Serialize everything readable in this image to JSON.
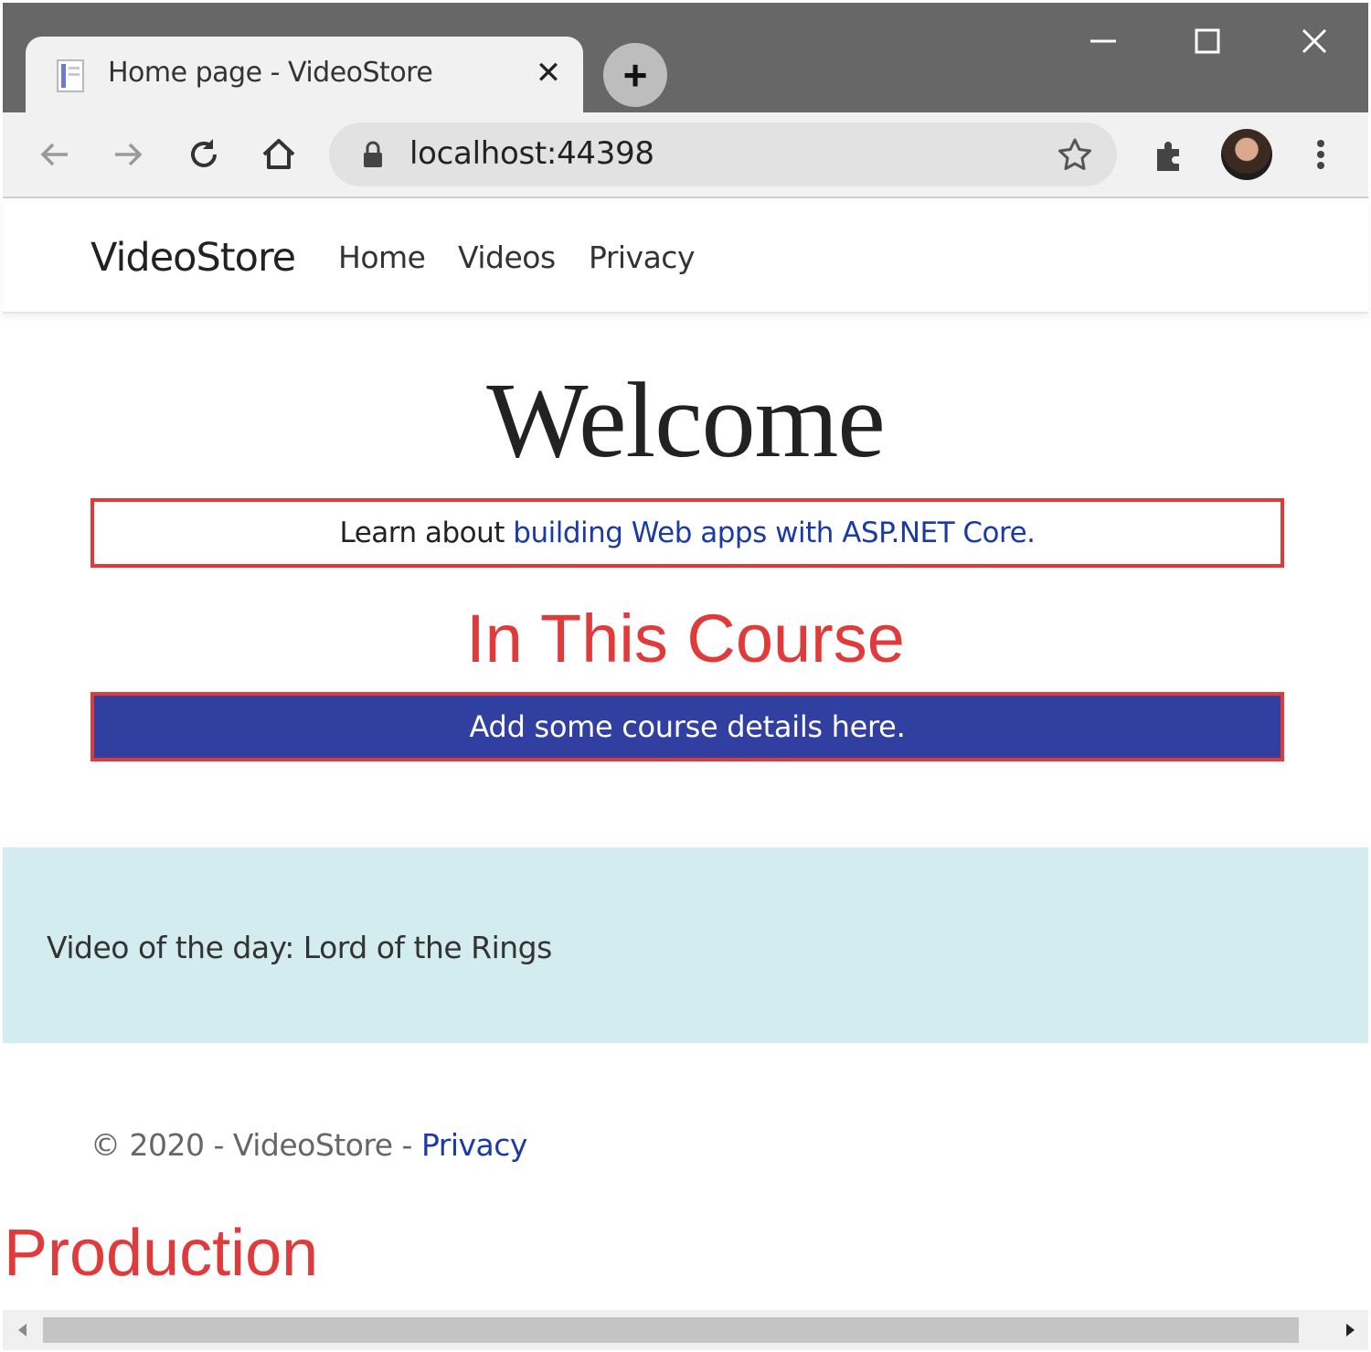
{
  "browser": {
    "tab_title": "Home page - VideoStore",
    "tab_close": "✕",
    "new_tab": "+",
    "url": "localhost:44398",
    "icons": [
      "back-icon",
      "forward-icon",
      "reload-icon",
      "home-icon",
      "lock-icon",
      "star-icon",
      "extensions-icon",
      "profile-avatar",
      "menu-icon"
    ]
  },
  "navbar": {
    "brand": "VideoStore",
    "links": [
      "Home",
      "Videos",
      "Privacy"
    ]
  },
  "main": {
    "welcome": "Welcome",
    "learn_prefix": "Learn about ",
    "learn_link": "building Web apps with ASP.NET Core",
    "learn_suffix": ".",
    "course_title": "In This Course",
    "course_details": "Add some course details here."
  },
  "video_of_day": "Video of the day: Lord of the Rings",
  "footer": {
    "text": "© 2020 - VideoStore - ",
    "privacy_link": "Privacy"
  },
  "environment": "Production",
  "colors": {
    "accent_red": "#e03a3a",
    "details_blue": "#3140a0",
    "link_blue": "#1a3aa8",
    "band_cyan": "#d3ecef"
  }
}
